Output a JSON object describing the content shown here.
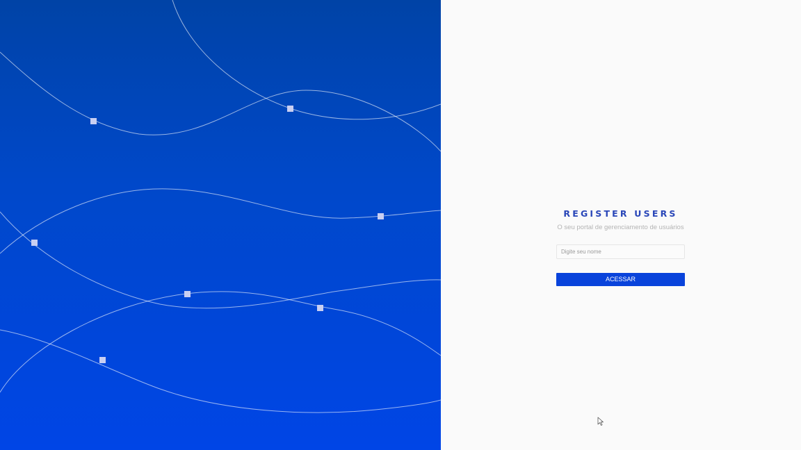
{
  "brand": {
    "title": "REGISTER USERS",
    "subtitle": "O seu portal de gerenciamento de usuários"
  },
  "form": {
    "name_placeholder": "Digite seu nome",
    "name_value": "",
    "submit_label": "ACESSAR"
  },
  "colors": {
    "accent": "#0943db",
    "title": "#2946b8",
    "panel_top": "#0043a6",
    "panel_bottom": "#0045e6"
  },
  "icons": {
    "cursor": "mouse-pointer-icon"
  }
}
